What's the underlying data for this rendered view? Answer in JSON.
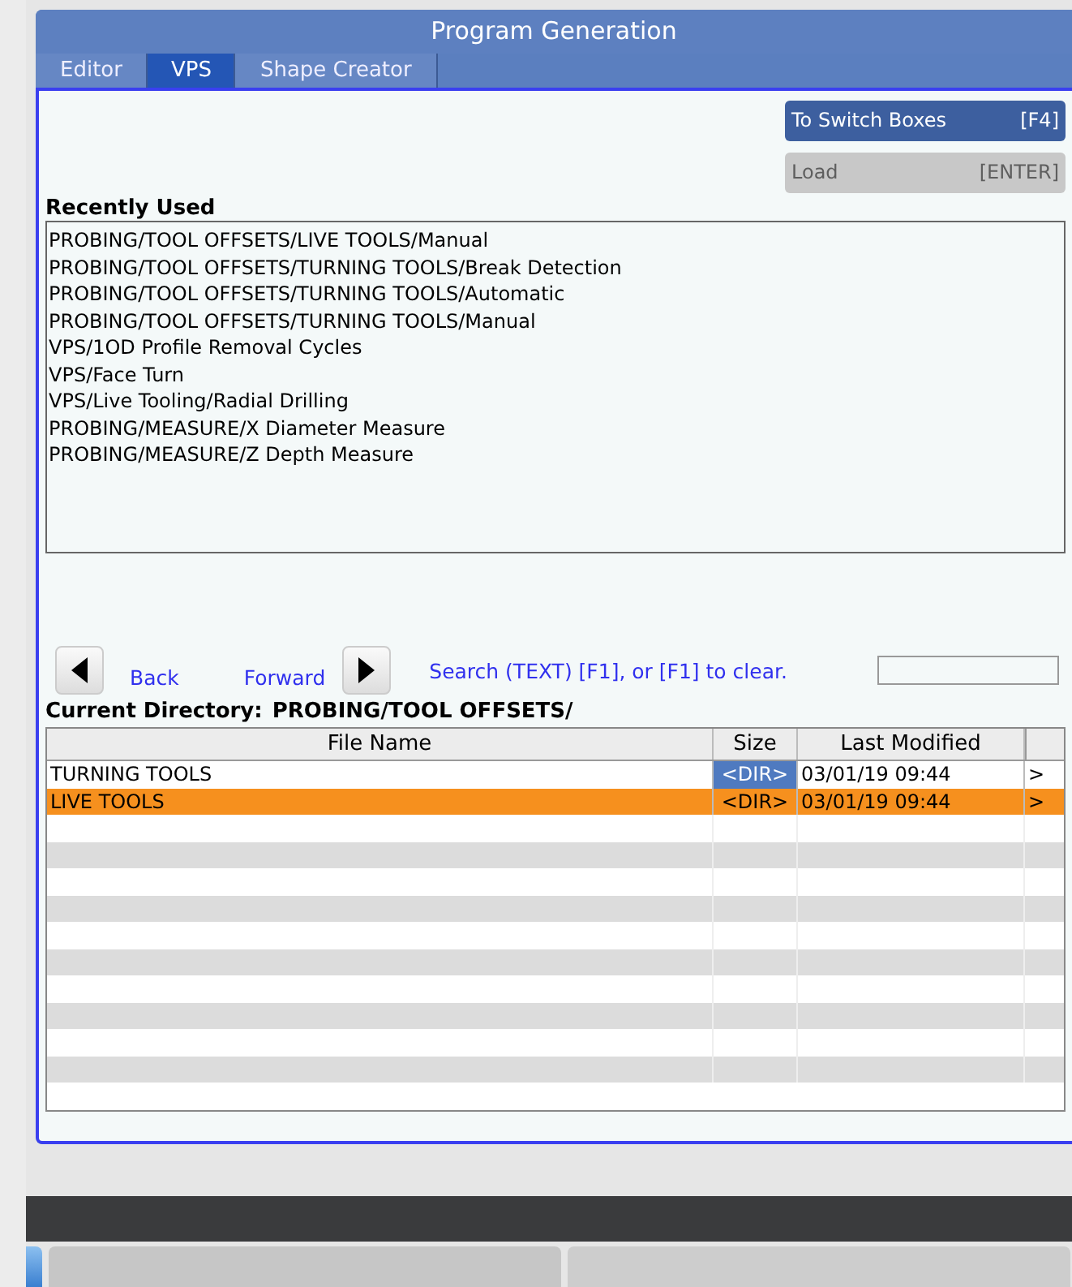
{
  "window": {
    "title": "Program Generation"
  },
  "tabs": [
    {
      "label": "Editor",
      "selected": false
    },
    {
      "label": "VPS",
      "selected": true
    },
    {
      "label": "Shape Creator",
      "selected": false
    }
  ],
  "buttons": [
    {
      "label": "To Switch Boxes",
      "key": "[F4]",
      "disabled": false
    },
    {
      "label": "Load",
      "key": "[ENTER]",
      "disabled": true
    }
  ],
  "recently_used": {
    "title": "Recently Used",
    "items": [
      "PROBING/TOOL OFFSETS/LIVE TOOLS/Manual",
      "PROBING/TOOL OFFSETS/TURNING TOOLS/Break Detection",
      "PROBING/TOOL OFFSETS/TURNING TOOLS/Automatic",
      "PROBING/TOOL OFFSETS/TURNING TOOLS/Manual",
      "VPS/1OD Profile Removal Cycles",
      "VPS/Face Turn",
      "VPS/Live Tooling/Radial Drilling",
      "PROBING/MEASURE/X Diameter Measure",
      "PROBING/MEASURE/Z Depth Measure"
    ]
  },
  "navigation": {
    "back": "Back",
    "forward": "Forward",
    "search_hint": "Search (TEXT) [F1], or [F1] to clear."
  },
  "current_directory": {
    "label": "Current Directory:",
    "path": "PROBING/TOOL OFFSETS/"
  },
  "table": {
    "columns": [
      "File Name",
      "Size",
      "Last Modified"
    ],
    "rows": [
      {
        "name": "TURNING TOOLS",
        "size": "<DIR>",
        "modified": "03/01/19 09:44",
        "arrow": ">",
        "selected": false,
        "size_focused": true
      },
      {
        "name": "LIVE TOOLS",
        "size": "<DIR>",
        "modified": "03/01/19 09:44",
        "arrow": ">",
        "selected": true,
        "size_focused": false
      }
    ]
  }
}
